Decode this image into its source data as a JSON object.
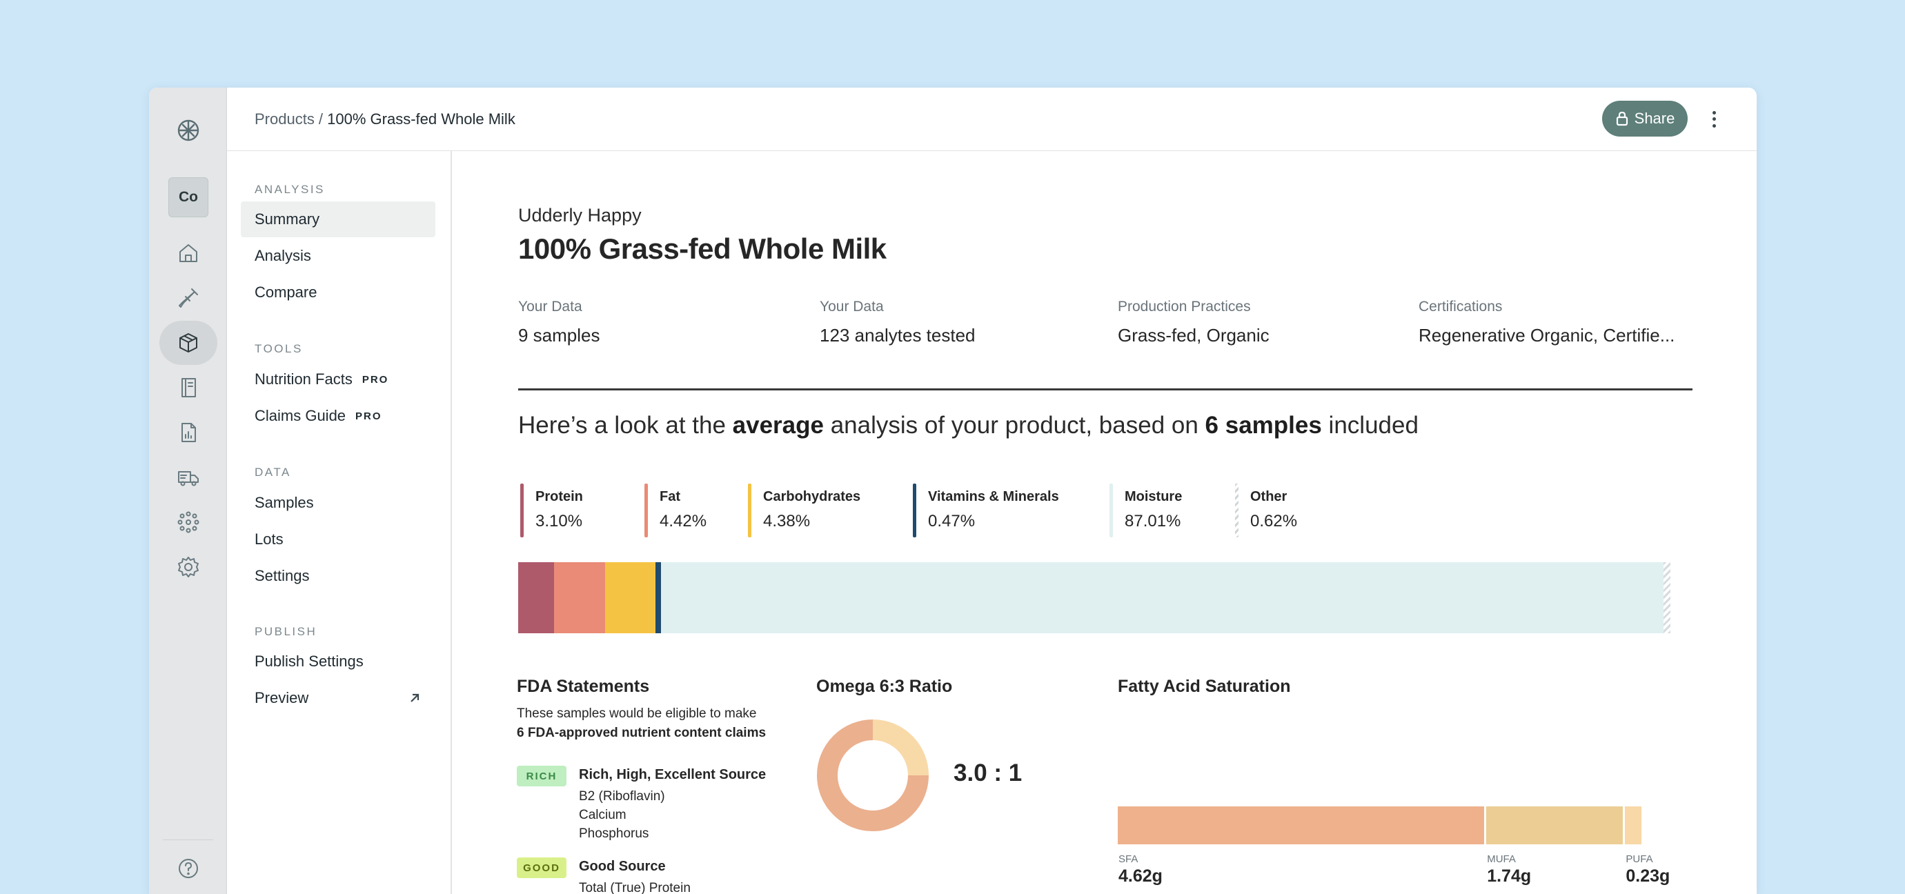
{
  "breadcrumb": {
    "parent": "Products /",
    "current": "100% Grass-fed Whole Milk"
  },
  "share_label": "Share",
  "workspace_initials": "Co",
  "nav": {
    "analysis_title": "ANALYSIS",
    "summary": "Summary",
    "analysis": "Analysis",
    "compare": "Compare",
    "tools_title": "TOOLS",
    "nutrition_facts": "Nutrition Facts",
    "claims_guide": "Claims Guide",
    "pro_badge": "PRO",
    "data_title": "DATA",
    "samples": "Samples",
    "lots": "Lots",
    "settings": "Settings",
    "publish_title": "PUBLISH",
    "publish_settings": "Publish Settings",
    "preview": "Preview"
  },
  "product": {
    "brand": "Udderly Happy",
    "name": "100% Grass-fed Whole Milk"
  },
  "stats": [
    {
      "label": "Your Data",
      "value": "9 samples"
    },
    {
      "label": "Your Data",
      "value": "123 analytes tested"
    },
    {
      "label": "Production Practices",
      "value": "Grass-fed, Organic"
    },
    {
      "label": "Certifications",
      "value": "Regenerative Organic, Certifie..."
    }
  ],
  "headline": {
    "p1": "Here’s a look at the ",
    "b1": "average",
    "p2": " analysis of your product, based on ",
    "b2": "6 samples",
    "p3": " included"
  },
  "composition": [
    {
      "name": "Protein",
      "value": "3.10%",
      "pct": 3.1,
      "color": "#ae5a6b"
    },
    {
      "name": "Fat",
      "value": "4.42%",
      "pct": 4.42,
      "color": "#e98b76"
    },
    {
      "name": "Carbohydrates",
      "value": "4.38%",
      "pct": 4.38,
      "color": "#f5c343"
    },
    {
      "name": "Vitamins & Minerals",
      "value": "0.47%",
      "pct": 0.47,
      "color": "#1f4b6e"
    },
    {
      "name": "Moisture",
      "value": "87.01%",
      "pct": 87.01,
      "color": "#e0f0f0"
    },
    {
      "name": "Other",
      "value": "0.62%",
      "pct": 0.62,
      "color": "hatch"
    }
  ],
  "fda": {
    "title": "FDA Statements",
    "desc_line1": "These samples would be eligible to make",
    "desc_line2": "6 FDA-approved nutrient content claims",
    "claims": [
      {
        "badge": "RICH",
        "name": "Rich, High, Excellent Source",
        "items": [
          "B2 (Riboflavin)",
          "Calcium",
          "Phosphorus"
        ],
        "badge_bg": "#bfeec0",
        "badge_fg": "#3b8a45"
      },
      {
        "badge": "GOOD",
        "name": "Good Source",
        "items": [
          "Total (True) Protein"
        ],
        "badge_bg": "#d9f08a",
        "badge_fg": "#5c6e12"
      }
    ]
  },
  "omega": {
    "title": "Omega 6:3 Ratio",
    "ratio": "3.0 : 1",
    "omega6": 3.0,
    "omega3": 1.0,
    "color6": "#ebb08e",
    "color3": "#f8d9a8"
  },
  "fatty_acid": {
    "title": "Fatty Acid Saturation",
    "segments": [
      {
        "label": "SFA",
        "value": "4.62g",
        "grams": 4.62,
        "color": "#efb18c"
      },
      {
        "label": "MUFA",
        "value": "1.74g",
        "grams": 1.74,
        "color": "#eccd93"
      },
      {
        "label": "PUFA",
        "value": "0.23g",
        "grams": 0.23,
        "color": "#f8d8a6"
      }
    ]
  }
}
